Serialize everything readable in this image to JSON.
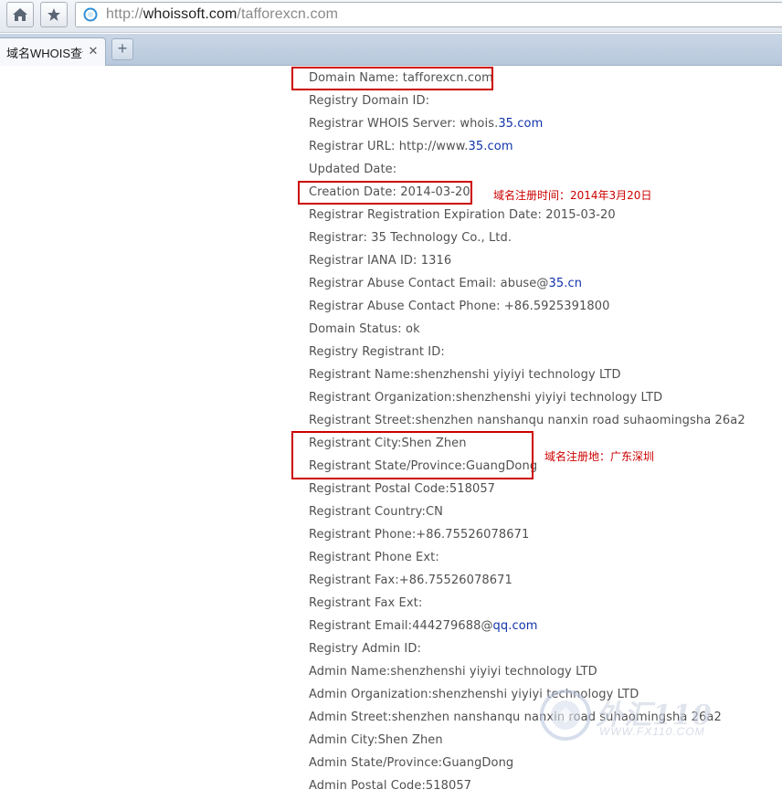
{
  "browser": {
    "url_prefix": "http://",
    "url_host": "whoissoft.com",
    "url_path": "/tafforexcn.com",
    "tab_title": "域名WHOIS查询",
    "tab_close": "✕",
    "new_tab": "+"
  },
  "whois_lines": [
    {
      "text": "Domain Name: tafforexcn.com"
    },
    {
      "text": "Registry Domain ID:"
    },
    {
      "text": "Registrar WHOIS Server: whois.",
      "link": "35.com"
    },
    {
      "text": "Registrar URL: http://www.",
      "link": "35.com"
    },
    {
      "text": "Updated Date:"
    },
    {
      "text": "Creation Date: 2014-03-20"
    },
    {
      "text": "Registrar Registration Expiration Date: 2015-03-20"
    },
    {
      "text": "Registrar: 35 Technology Co., Ltd."
    },
    {
      "text": "Registrar IANA ID: 1316"
    },
    {
      "text": "Registrar Abuse Contact Email: abuse@",
      "link": "35.cn"
    },
    {
      "text": "Registrar Abuse Contact Phone: +86.5925391800"
    },
    {
      "text": "Domain Status: ok"
    },
    {
      "text": "Registry Registrant ID:"
    },
    {
      "text": "Registrant Name:shenzhenshi yiyiyi technology LTD"
    },
    {
      "text": "Registrant Organization:shenzhenshi yiyiyi technology LTD"
    },
    {
      "text": "Registrant Street:shenzhen nanshanqu nanxin road suhaomingsha 26a2"
    },
    {
      "text": "Registrant City:Shen Zhen"
    },
    {
      "text": "Registrant State/Province:GuangDong"
    },
    {
      "text": "Registrant Postal Code:518057"
    },
    {
      "text": "Registrant Country:CN"
    },
    {
      "text": "Registrant Phone:+86.75526078671"
    },
    {
      "text": "Registrant Phone Ext:"
    },
    {
      "text": "Registrant Fax:+86.75526078671"
    },
    {
      "text": "Registrant Fax Ext:"
    },
    {
      "text": "Registrant Email:444279688@",
      "link": "qq.com"
    },
    {
      "text": "Registry Admin ID:"
    },
    {
      "text": "Admin Name:shenzhenshi yiyiyi technology LTD"
    },
    {
      "text": "Admin Organization:shenzhenshi yiyiyi technology LTD"
    },
    {
      "text": "Admin Street:shenzhen nanshanqu nanxin road suhaomingsha 26a2"
    },
    {
      "text": "Admin City:Shen Zhen"
    },
    {
      "text": "Admin State/Province:GuangDong"
    },
    {
      "text": "Admin Postal Code:518057"
    }
  ],
  "annotations": {
    "creation_note": "域名注册时间：2014年3月20日",
    "location_note": "域名注册地：广东深圳"
  },
  "watermark": {
    "text": "外汇110",
    "url": "WWW.FX110.COM"
  },
  "colors": {
    "highlight": "#cc0000",
    "link": "#1133aa",
    "text": "#505050"
  },
  "icons": {
    "home_button": "home-icon",
    "bookmark_button": "star-icon",
    "url_security": "globe-icon"
  }
}
